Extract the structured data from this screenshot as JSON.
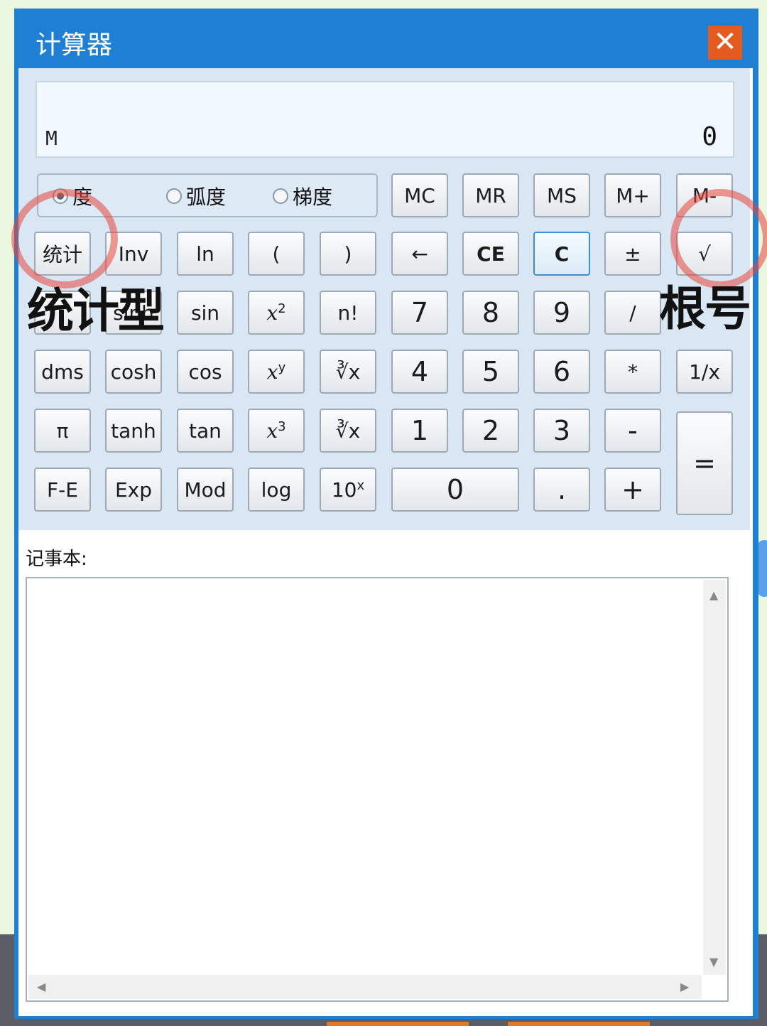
{
  "window": {
    "title": "计算器",
    "close_glyph": "✕"
  },
  "display": {
    "memory_indicator": "M",
    "value": "0"
  },
  "angle_modes": [
    {
      "label": "度",
      "selected": true
    },
    {
      "label": "弧度",
      "selected": false
    },
    {
      "label": "梯度",
      "selected": false
    }
  ],
  "keys": {
    "mc": "MC",
    "mr": "MR",
    "ms": "MS",
    "mplus": "M+",
    "mminus": "M-",
    "stat": "统计",
    "inv": "Inv",
    "ln": "ln",
    "lparen": "(",
    "rparen": ")",
    "back": "←",
    "ce": "CE",
    "c": "C",
    "plusminus": "±",
    "sqrt": "√",
    "sinh": "sinh",
    "sin": "sin",
    "x2_base": "x",
    "x2_exp": "2",
    "fact": "n!",
    "seven": "7",
    "eight": "8",
    "nine": "9",
    "divide": "/",
    "percent": "%",
    "dms": "dms",
    "cosh": "cosh",
    "cos": "cos",
    "xy_base": "x",
    "xy_exp": "y",
    "yroot": "∛x",
    "four": "4",
    "five": "5",
    "six": "6",
    "multiply": "*",
    "recip": "1/x",
    "pi": "π",
    "tanh": "tanh",
    "tan": "tan",
    "x3_base": "x",
    "x3_exp": "3",
    "cuberoot": "∛x",
    "one": "1",
    "two": "2",
    "three": "3",
    "minus": "-",
    "equals": "=",
    "fe": "F-E",
    "exp": "Exp",
    "mod": "Mod",
    "log": "log",
    "tenx_base": "10",
    "tenx_exp": "x",
    "zero": "0",
    "dot": ".",
    "plus": "+"
  },
  "annotations": {
    "left": "统计型",
    "right": "根号"
  },
  "notepad": {
    "label": "记事本:"
  }
}
